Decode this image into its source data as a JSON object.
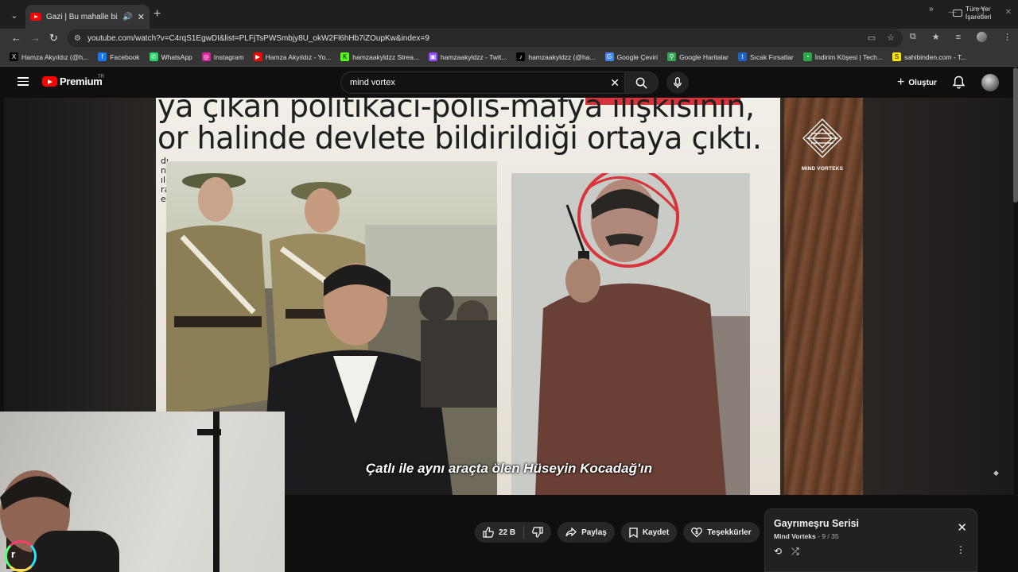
{
  "browser": {
    "tab_title": "Gazi | Bu mahalle bizim [bölüm",
    "url": "youtube.com/watch?v=C4rqS1EgwDI&list=PLFjTsPWSmbjy8U_okW2Fl6hHb7iZOupKw&index=9",
    "bookmarks": [
      {
        "label": "Hamza Akyıldız (@h...",
        "icon": "x-icon",
        "color": "#000000",
        "glyph": "X"
      },
      {
        "label": "Facebook",
        "icon": "facebook-icon",
        "color": "#1877f2",
        "glyph": "f"
      },
      {
        "label": "WhatsApp",
        "icon": "whatsapp-icon",
        "color": "#25d366",
        "glyph": "✆"
      },
      {
        "label": "Instagram",
        "icon": "instagram-icon",
        "color": "#d6249f",
        "glyph": "◎"
      },
      {
        "label": "Hamza Akyıldız - Yo...",
        "icon": "youtube-icon",
        "color": "#ff0000",
        "glyph": "▶"
      },
      {
        "label": "hamzaakyldzz Strea...",
        "icon": "kick-icon",
        "color": "#53fc18",
        "glyph": "K"
      },
      {
        "label": "hamzaakyldzz - Twit...",
        "icon": "twitch-icon",
        "color": "#9146ff",
        "glyph": "▣"
      },
      {
        "label": "hamzaakyldzz (@ha...",
        "icon": "tiktok-icon",
        "color": "#000000",
        "glyph": "♪"
      },
      {
        "label": "Google Çeviri",
        "icon": "translate-icon",
        "color": "#4285f4",
        "glyph": "G"
      },
      {
        "label": "Google Haritalar",
        "icon": "maps-icon",
        "color": "#34a853",
        "glyph": "⚲"
      },
      {
        "label": "Sıcak Fırsatlar",
        "icon": "deals-icon",
        "color": "#1e64c8",
        "glyph": "t"
      },
      {
        "label": "İndirim Köşesi | Tech...",
        "icon": "discount-icon",
        "color": "#2aa84a",
        "glyph": "◔"
      },
      {
        "label": "sahibinden.com - T...",
        "icon": "sahibinden-icon",
        "color": "#ffe800",
        "glyph": "S"
      }
    ],
    "all_bookmarks_label": "Tüm Yer İşaretleri"
  },
  "youtube": {
    "logo_text": "Premium",
    "logo_region": "TR",
    "search_value": "mind vortex",
    "create_label": "Oluştur"
  },
  "video": {
    "headline_lines": [
      "ya çıkan politikacı-polis-mafya ilişkisinin,",
      "or halinde devlete bildirildiği ortaya çıktı."
    ],
    "side_text": [
      "dı",
      "n",
      "ıl-",
      "ra",
      "e-"
    ],
    "brand_name": "MIND VORTEKS",
    "subtitle": "Çatlı ile aynı araçta ölen Hüseyin Kocadağ'ın"
  },
  "actions": {
    "likes": "22 B",
    "share": "Paylaş",
    "save": "Kaydet",
    "thanks": "Teşekkürler"
  },
  "playlist": {
    "title": "Gayrımeşru Serisi",
    "channel": "Mind Vorteks",
    "position": "9 / 35"
  },
  "colors": {
    "youtube_red": "#ff0000",
    "circle_red": "#d8343b",
    "background": "#0f0f0f"
  }
}
